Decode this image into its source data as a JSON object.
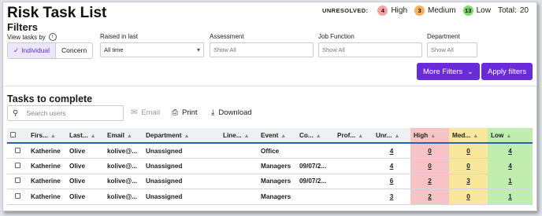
{
  "title": "Risk Task List",
  "unresolved": {
    "label": "UNRESOLVED:",
    "high": {
      "count": "4",
      "label": "High"
    },
    "medium": {
      "count": "3",
      "label": "Medium"
    },
    "low": {
      "count": "13",
      "label": "Low"
    },
    "total_label": "Total:",
    "total_value": "20"
  },
  "filters": {
    "title": "Filters",
    "view_label": "View tasks by",
    "view_options": {
      "individual": "Individual",
      "concern": "Concern"
    },
    "raised_label": "Raised in last",
    "raised_value": "All time",
    "assessment_label": "Assessment",
    "assessment_placeholder": "Show All",
    "job_function_label": "Job Function",
    "job_function_placeholder": "Show All",
    "department_label": "Department",
    "department_placeholder": "Show All",
    "more_filters": "More Filters",
    "apply_filters": "Apply filters"
  },
  "tasks": {
    "title": "Tasks to complete",
    "search_placeholder": "Search users",
    "email_label": "Email",
    "print_label": "Print",
    "download_label": "Download",
    "columns": [
      "Firs...",
      "Last...",
      "Email",
      "Department",
      "Line...",
      "Event",
      "Co...",
      "Prof...",
      "Unr...",
      "High",
      "Med...",
      "Low"
    ],
    "rows": [
      {
        "first": "Katherine",
        "last": "Olive",
        "email": "kolive@...",
        "department": "Unassigned",
        "line": "",
        "event": "Office",
        "co": "",
        "prof": "",
        "unr": "4",
        "high": "0",
        "med": "0",
        "low": "4"
      },
      {
        "first": "Katherine",
        "last": "Olive",
        "email": "kolive@...",
        "department": "Unassigned",
        "line": "",
        "event": "Managers",
        "co": "09/07/2...",
        "prof": "",
        "unr": "4",
        "high": "0",
        "med": "0",
        "low": "4"
      },
      {
        "first": "Katherine",
        "last": "Olive",
        "email": "kolive@...",
        "department": "Unassigned",
        "line": "",
        "event": "Managers",
        "co": "09/07/2...",
        "prof": "",
        "unr": "6",
        "high": "2",
        "med": "3",
        "low": "1"
      },
      {
        "first": "Katherine",
        "last": "Olive",
        "email": "kolive@...",
        "department": "Unassigned",
        "line": "",
        "event": "Managers",
        "co": "",
        "prof": "",
        "unr": "3",
        "high": "2",
        "med": "0",
        "low": "1"
      }
    ]
  },
  "colors": {
    "accent": "#6a2bd9",
    "high": "#f6c4c4",
    "medium": "#f8e79c",
    "low": "#bfeeb0",
    "header_rule": "#2a5fbf"
  }
}
